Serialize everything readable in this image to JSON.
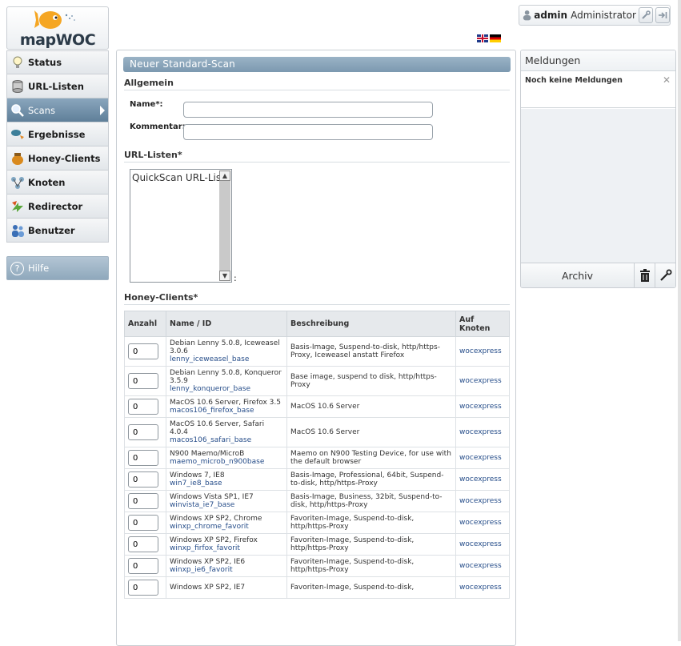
{
  "app": {
    "logo_text": "mapWOC"
  },
  "sidebar": {
    "items": [
      {
        "label": "Status",
        "icon": "lightbulb-icon"
      },
      {
        "label": "URL-Listen",
        "icon": "database-icon"
      },
      {
        "label": "Scans",
        "icon": "magnifier-icon",
        "active": true
      },
      {
        "label": "Ergebnisse",
        "icon": "results-icon"
      },
      {
        "label": "Honey-Clients",
        "icon": "honeypot-icon"
      },
      {
        "label": "Knoten",
        "icon": "nodes-icon"
      },
      {
        "label": "Redirector",
        "icon": "redirect-icon"
      },
      {
        "label": "Benutzer",
        "icon": "users-icon"
      }
    ],
    "help_label": "Hilfe"
  },
  "topbar": {
    "languages": [
      "en",
      "de"
    ],
    "user_name": "admin",
    "user_role": "Administrator"
  },
  "main": {
    "title": "Neuer Standard-Scan",
    "section_general": "Allgemein",
    "name_label": "Name*:",
    "name_value": "",
    "comment_label": "Kommentar:",
    "comment_value": "",
    "section_urllists": "URL-Listen*",
    "url_lists": [
      "QuickScan URL-List"
    ],
    "listbox_suffix": ":",
    "section_honeyclients": "Honey-Clients*",
    "table_headers": {
      "qty": "Anzahl",
      "name": "Name / ID",
      "desc": "Beschreibung",
      "node": "Auf Knoten"
    },
    "honey_clients": [
      {
        "qty": "0",
        "name": "Debian Lenny 5.0.8, Iceweasel 3.0.6",
        "id": "lenny_iceweasel_base",
        "desc": "Basis-Image, Suspend-to-disk, http/https-Proxy, Iceweasel anstatt Firefox",
        "node": "wocexpress"
      },
      {
        "qty": "0",
        "name": "Debian Lenny 5.0.8, Konqueror 3.5.9",
        "id": "lenny_konqueror_base",
        "desc": "Base image, suspend to disk, http/https-Proxy",
        "node": "wocexpress"
      },
      {
        "qty": "0",
        "name": "MacOS 10.6 Server, Firefox 3.5",
        "id": "macos106_firefox_base",
        "desc": "MacOS 10.6 Server",
        "node": "wocexpress"
      },
      {
        "qty": "0",
        "name": "MacOS 10.6 Server, Safari 4.0.4",
        "id": "macos106_safari_base",
        "desc": "MacOS 10.6 Server",
        "node": "wocexpress"
      },
      {
        "qty": "0",
        "name": "N900 Maemo/MicroB",
        "id": "maemo_microb_n900base",
        "desc": "Maemo on N900 Testing Device, for use with the default browser",
        "node": "wocexpress"
      },
      {
        "qty": "0",
        "name": "Windows 7, IE8",
        "id": "win7_ie8_base",
        "desc": "Basis-Image, Professional, 64bit, Suspend-to-disk, http/https-Proxy",
        "node": "wocexpress"
      },
      {
        "qty": "0",
        "name": "Windows Vista SP1, IE7",
        "id": "winvista_ie7_base",
        "desc": "Basis-Image, Business, 32bit, Suspend-to-disk, http/https-Proxy",
        "node": "wocexpress"
      },
      {
        "qty": "0",
        "name": "Windows XP SP2, Chrome",
        "id": "winxp_chrome_favorit",
        "desc": "Favoriten-Image, Suspend-to-disk, http/https-Proxy",
        "node": "wocexpress"
      },
      {
        "qty": "0",
        "name": "Windows XP SP2, Firefox",
        "id": "winxp_firfox_favorit",
        "desc": "Favoriten-Image, Suspend-to-disk, http/https-Proxy",
        "node": "wocexpress"
      },
      {
        "qty": "0",
        "name": "Windows XP SP2, IE6",
        "id": "winxp_ie6_favorit",
        "desc": "Favoriten-Image, Suspend-to-disk, http/https-Proxy",
        "node": "wocexpress"
      },
      {
        "qty": "0",
        "name": "Windows XP SP2, IE7",
        "id": "",
        "desc": "Favoriten-Image, Suspend-to-disk,",
        "node": "wocexpress"
      }
    ]
  },
  "messages": {
    "title": "Meldungen",
    "empty_text": "Noch keine Meldungen",
    "archive_label": "Archiv"
  }
}
